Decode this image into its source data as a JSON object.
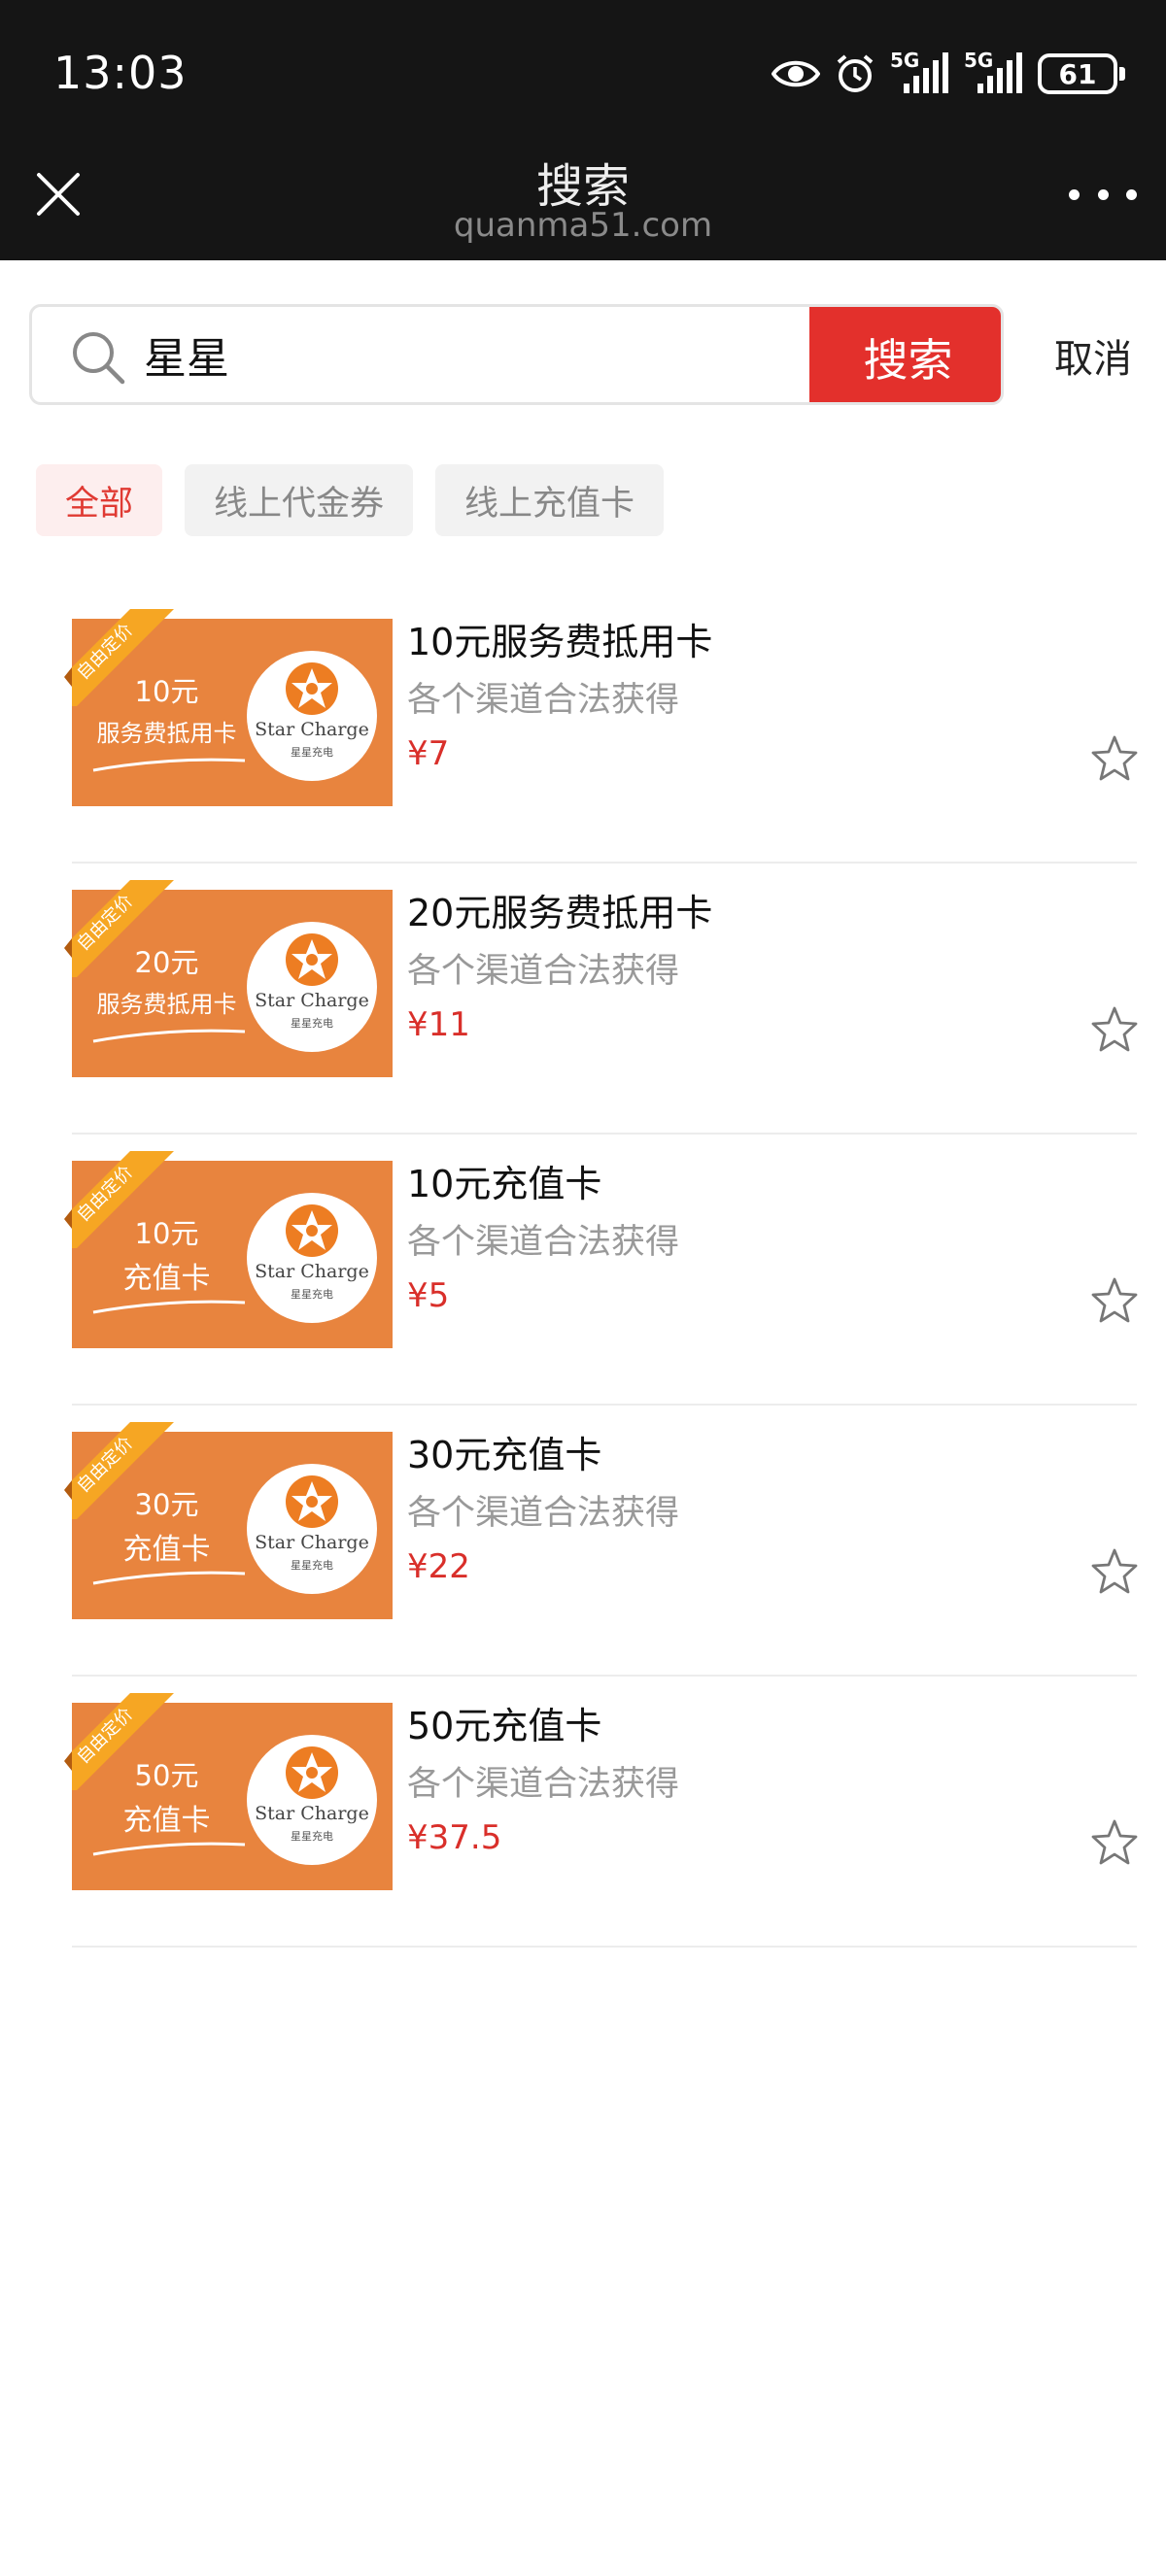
{
  "status_bar": {
    "time": "13:03",
    "signal1": "5G",
    "signal2": "5G",
    "battery": "61"
  },
  "nav": {
    "title": "搜索",
    "subtitle": "quanma51.com"
  },
  "search": {
    "query": "星星",
    "button_label": "搜索",
    "cancel_label": "取消"
  },
  "filters": [
    {
      "label": "全部",
      "active": true
    },
    {
      "label": "线上代金券",
      "active": false
    },
    {
      "label": "线上充值卡",
      "active": false
    }
  ],
  "card_common": {
    "ribbon_text": "自由定价",
    "brand_name": "Star Charge",
    "brand_sub": "星星充电"
  },
  "items": [
    {
      "thumb_amount": "10元",
      "thumb_label": "服务费抵用卡",
      "title": "10元服务费抵用卡",
      "desc": "各个渠道合法获得",
      "price": "¥7"
    },
    {
      "thumb_amount": "20元",
      "thumb_label": "服务费抵用卡",
      "title": "20元服务费抵用卡",
      "desc": "各个渠道合法获得",
      "price": "¥11"
    },
    {
      "thumb_amount": "10元",
      "thumb_label": "充值卡",
      "title": "10元充值卡",
      "desc": "各个渠道合法获得",
      "price": "¥5"
    },
    {
      "thumb_amount": "30元",
      "thumb_label": "充值卡",
      "title": "30元充值卡",
      "desc": "各个渠道合法获得",
      "price": "¥22"
    },
    {
      "thumb_amount": "50元",
      "thumb_label": "充值卡",
      "title": "50元充值卡",
      "desc": "各个渠道合法获得",
      "price": "¥37.5"
    }
  ],
  "colors": {
    "accent": "#e3302c",
    "price": "#d92f2a",
    "card": "#e8843e",
    "ribbon": "#f6a623"
  }
}
